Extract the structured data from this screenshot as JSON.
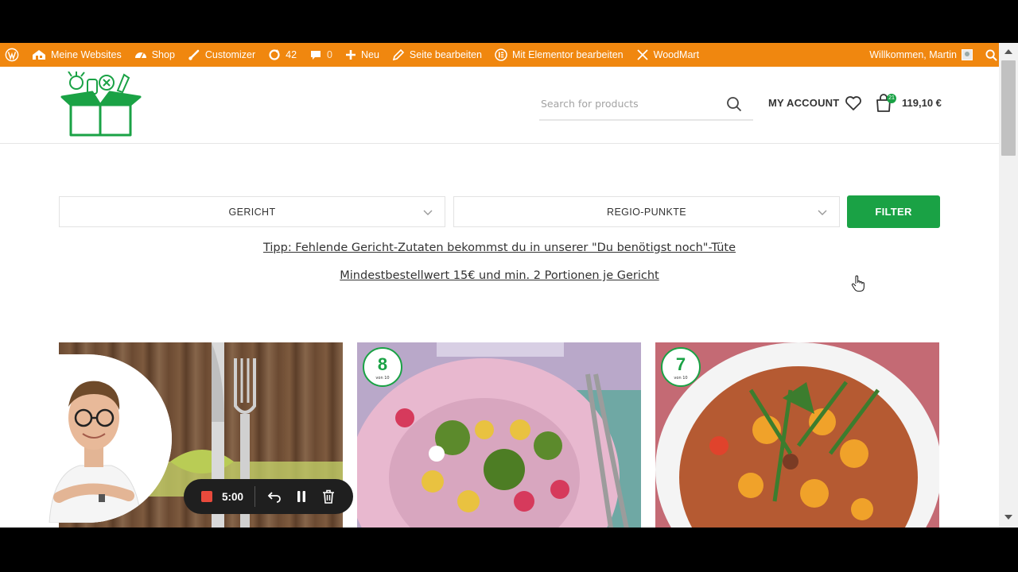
{
  "adminbar": {
    "my_sites": "Meine Websites",
    "shop": "Shop",
    "customizer": "Customizer",
    "updates_count": "42",
    "comments_count": "0",
    "new": "Neu",
    "edit_page": "Seite bearbeiten",
    "elementor": "Mit Elementor bearbeiten",
    "woodmart": "WoodMart",
    "welcome": "Willkommen, Martin"
  },
  "header": {
    "search_placeholder": "Search for products",
    "my_account": "MY ACCOUNT",
    "cart_count": "21",
    "cart_total": "119,10 €"
  },
  "filters": {
    "dropdown_1": "GERICHT",
    "dropdown_2": "REGIO-PUNKTE",
    "button": "FILTER"
  },
  "tips": {
    "line_1": "Tipp: Fehlende Gericht-Zutaten bekommst du in unserer \"Du benötigst noch\"-Tüte",
    "line_2": "Mindestbestellwert 15€ und min. 2 Portionen je Gericht"
  },
  "products": [
    {
      "badge": ""
    },
    {
      "badge": "8",
      "badge_sub": "von 10"
    },
    {
      "badge": "7",
      "badge_sub": "von 10"
    }
  ],
  "recorder": {
    "time": "5:00"
  },
  "colors": {
    "admin_bar": "#f0870f",
    "brand_green": "#1aa245",
    "recorder_bg": "#1f1f1f",
    "record_red": "#e84a3c"
  }
}
